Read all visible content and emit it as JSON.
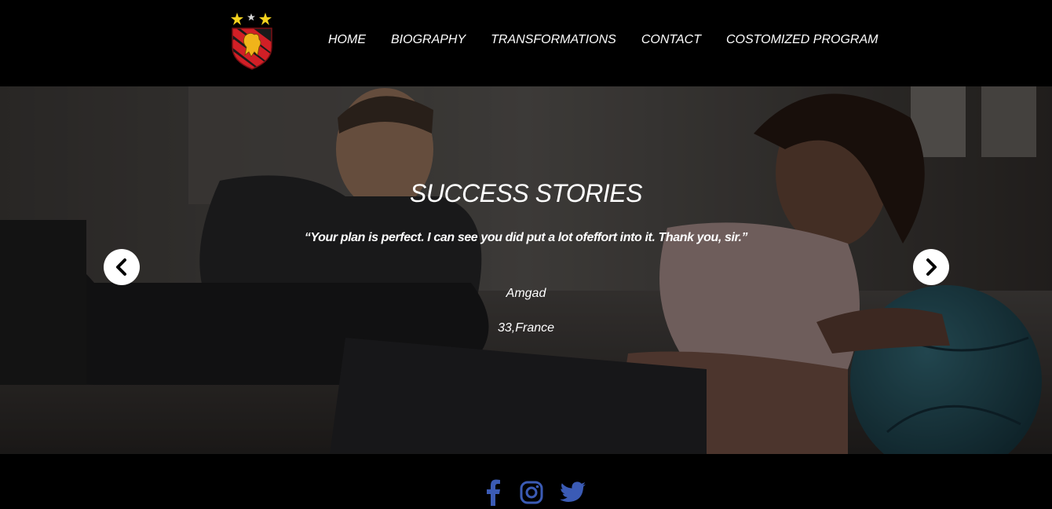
{
  "header": {
    "nav": [
      {
        "label": "HOME"
      },
      {
        "label": "BIOGRAPHY"
      },
      {
        "label": "TRANSFORMATIONS"
      },
      {
        "label": "CONTACT"
      },
      {
        "label": "COSTOMIZED PROGRAM"
      }
    ]
  },
  "hero": {
    "title": "SUCCESS STORIES",
    "quote": "“Your plan is perfect. I can see you did put a lot ofeffort into it. Thank you, sir.”",
    "name": "Amgad",
    "meta": "33,France",
    "prev_icon": "chevron-left-icon",
    "next_icon": "chevron-right-icon"
  },
  "footer": {
    "social": [
      {
        "icon": "facebook-icon"
      },
      {
        "icon": "instagram-icon"
      },
      {
        "icon": "twitter-icon"
      }
    ],
    "social_color": "#3b5bb5"
  }
}
